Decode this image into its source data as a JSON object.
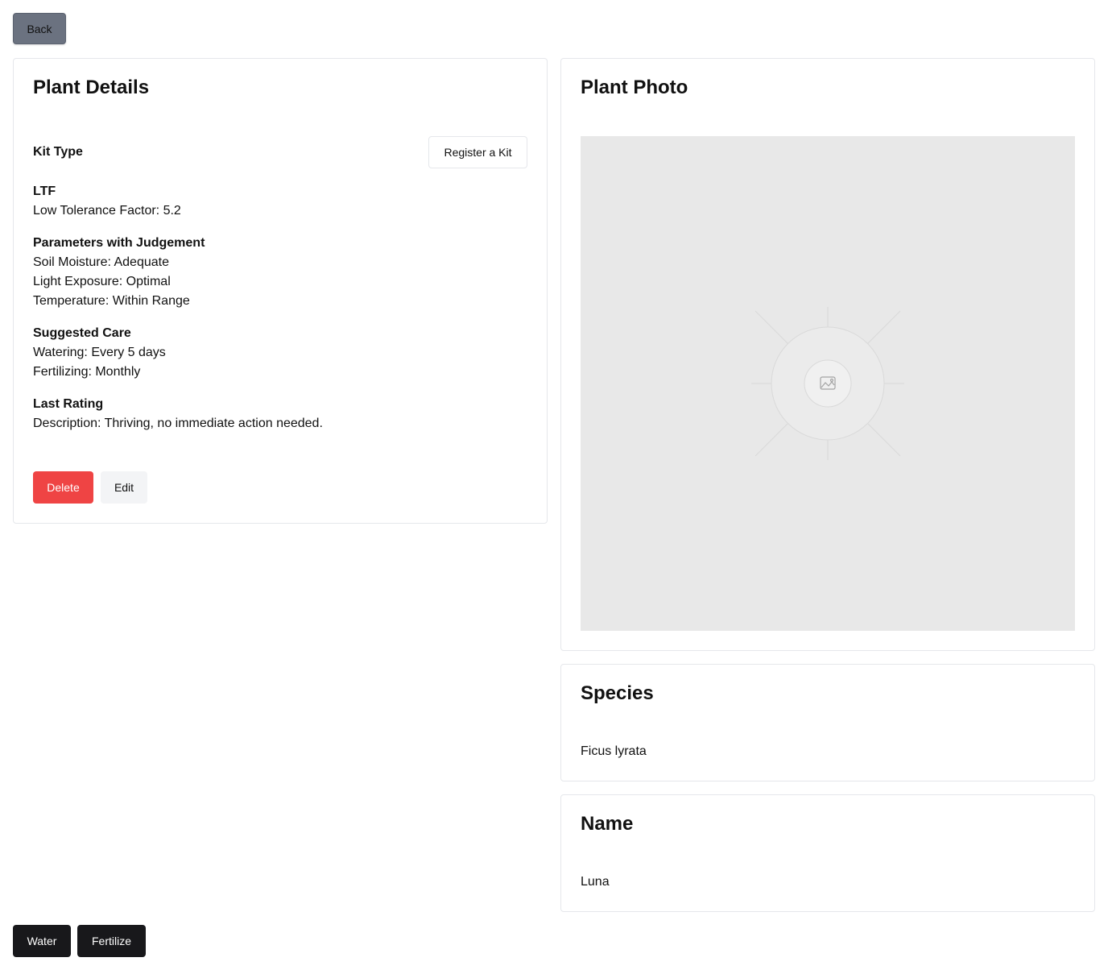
{
  "nav": {
    "back_label": "Back"
  },
  "details": {
    "title": "Plant Details",
    "kit_type_label": "Kit Type",
    "register_kit_label": "Register a Kit",
    "ltf": {
      "heading": "LTF",
      "lines": [
        "Low Tolerance Factor: 5.2"
      ]
    },
    "parameters": {
      "heading": "Parameters with Judgement",
      "lines": [
        "Soil Moisture: Adequate",
        "Light Exposure: Optimal",
        "Temperature: Within Range"
      ]
    },
    "care": {
      "heading": "Suggested Care",
      "lines": [
        "Watering: Every 5 days",
        "Fertilizing: Monthly"
      ]
    },
    "rating": {
      "heading": "Last Rating",
      "lines": [
        "Description: Thriving, no immediate action needed."
      ]
    },
    "delete_label": "Delete",
    "edit_label": "Edit"
  },
  "photo": {
    "title": "Plant Photo",
    "placeholder_icon": "image-placeholder-icon"
  },
  "species": {
    "title": "Species",
    "value": "Ficus lyrata"
  },
  "name": {
    "title": "Name",
    "value": "Luna"
  },
  "actions": {
    "water_label": "Water",
    "fertilize_label": "Fertilize"
  },
  "colors": {
    "back_button": "#6b7280",
    "delete_button": "#ef4444",
    "edit_button": "#f3f4f6",
    "action_button": "#18181b",
    "photo_placeholder": "#e8e8e8"
  }
}
